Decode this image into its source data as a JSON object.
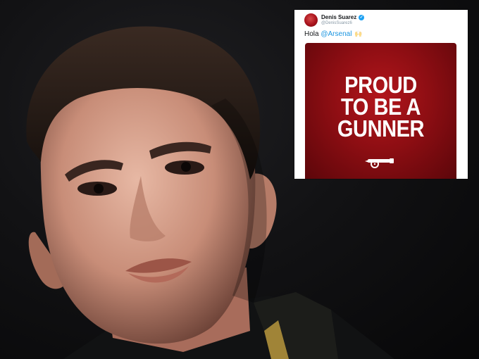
{
  "tweet": {
    "author_name": "Denis Suarez",
    "author_handle": "@DenisSuarez6",
    "text_prefix": "Hola ",
    "mention": "@Arsenal",
    "emoji": "🙌",
    "media": {
      "lines": [
        "PROUD",
        "TO BE A",
        "GUNNER"
      ],
      "icon": "cannon-crest-icon"
    }
  },
  "colors": {
    "arsenal_red": "#9a1016",
    "twitter_blue": "#1da1f2",
    "mention_blue": "#1b95e0"
  }
}
